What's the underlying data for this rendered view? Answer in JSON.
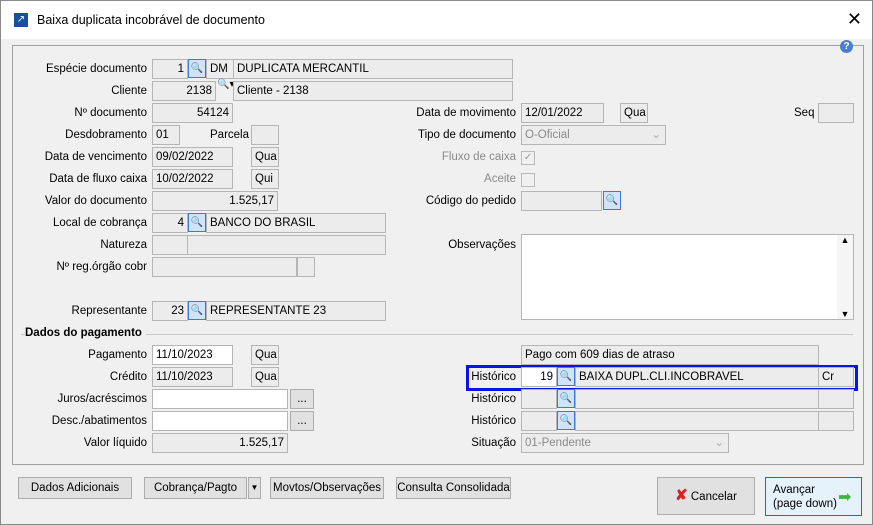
{
  "window": {
    "title": "Baixa duplicata incobrável de documento",
    "close": "✕",
    "help": "?"
  },
  "doc": {
    "especie_label": "Espécie documento",
    "especie_code": "1",
    "especie_sigla": "DM",
    "especie_desc": "DUPLICATA MERCANTIL",
    "cliente_label": "Cliente",
    "cliente_code": "2138",
    "cliente_desc": "Cliente - 2138",
    "numdoc_label": "Nº documento",
    "numdoc": "54124",
    "desdob_label": "Desdobramento",
    "desdob": "01",
    "parcela_label": "Parcela",
    "parcela": "",
    "venc_label": "Data de vencimento",
    "venc": "09/02/2022",
    "venc_dia": "Qua",
    "fluxo_label": "Data de fluxo caixa",
    "fluxo": "10/02/2022",
    "fluxo_dia": "Qui",
    "valor_label": "Valor do documento",
    "valor": "1.525,17",
    "local_label": "Local de cobrança",
    "local_code": "4",
    "local_desc": "BANCO DO BRASIL",
    "natureza_label": "Natureza",
    "nreg_label": "Nº reg.órgão cobr",
    "repr_label": "Representante",
    "repr_code": "23",
    "repr_desc": "REPRESENTANTE 23",
    "datamov_label": "Data de movimento",
    "datamov": "12/01/2022",
    "datamov_dia": "Qua",
    "seq_label": "Seq",
    "tipo_label": "Tipo de documento",
    "tipo": "O-Oficial",
    "fluxocaixa_label": "Fluxo de caixa",
    "aceite_label": "Aceite",
    "codped_label": "Código do pedido",
    "obs_label": "Observações"
  },
  "pag": {
    "header": "Dados do pagamento",
    "pagamento_label": "Pagamento",
    "pagamento": "11/10/2023",
    "pagamento_dia": "Qua",
    "credito_label": "Crédito",
    "credito": "11/10/2023",
    "credito_dia": "Qua",
    "juros_label": "Juros/acréscimos",
    "desc_label": "Desc./abatimentos",
    "ellipsis": "...",
    "liquido_label": "Valor líquido",
    "liquido": "1.525,17",
    "atraso": "Pago com 609 dias de atraso",
    "hist_label": "Histórico",
    "hist1_code": "19",
    "hist1_desc": "BAIXA DUPL.CLI.INCOBRAVEL",
    "hist1_dc": "Cr",
    "situacao_label": "Situação",
    "situacao": "01-Pendente"
  },
  "buttons": {
    "dados": "Dados Adicionais",
    "cobranca": "Cobrança/Pagto",
    "movtos": "Movtos/Observações",
    "consulta": "Consulta Consolidada",
    "cancelar": "Cancelar",
    "avancar": "Avançar",
    "avancar_sub": "(page down)"
  }
}
